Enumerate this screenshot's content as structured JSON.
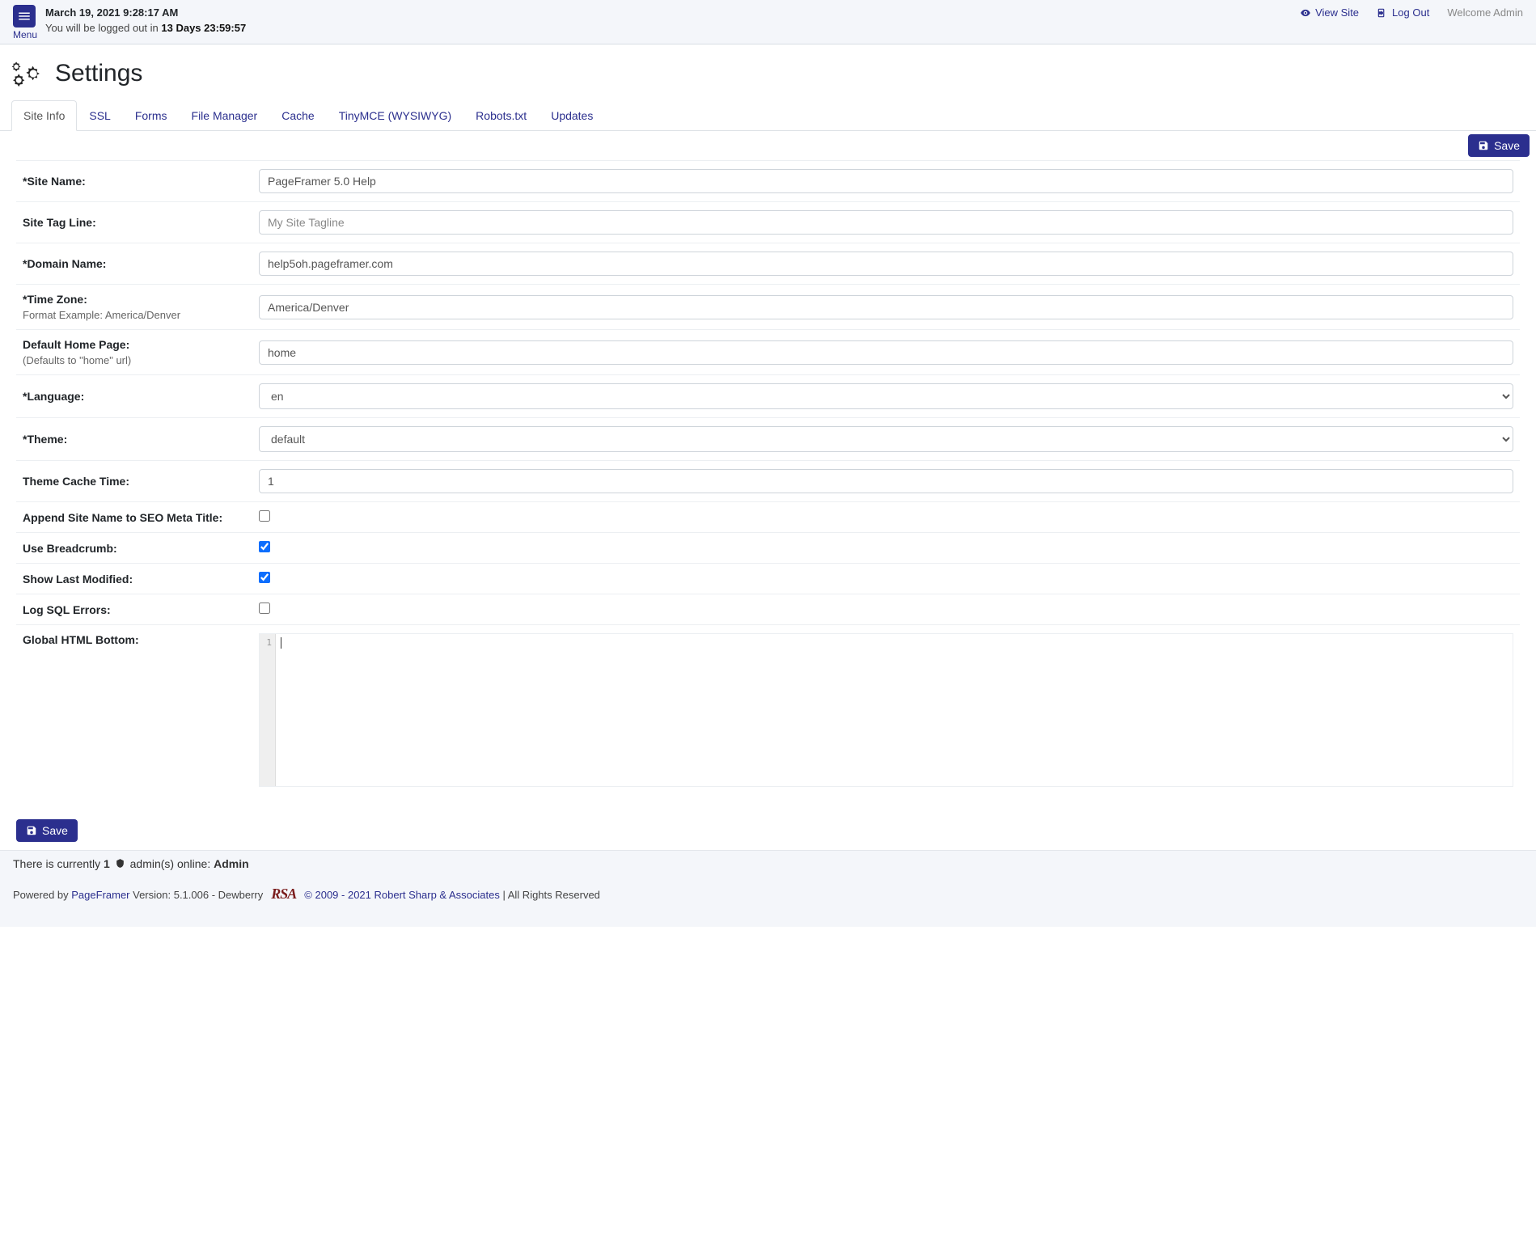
{
  "header": {
    "menu_label": "Menu",
    "datetime": "March 19, 2021 9:28:17 AM",
    "logout_prefix": "You will be logged out in ",
    "logout_time": "13 Days 23:59:57",
    "view_site": "View Site",
    "log_out": "Log Out",
    "welcome": "Welcome Admin"
  },
  "page": {
    "title": "Settings"
  },
  "tabs": [
    {
      "label": "Site Info",
      "active": true
    },
    {
      "label": "SSL"
    },
    {
      "label": "Forms"
    },
    {
      "label": "File Manager"
    },
    {
      "label": "Cache"
    },
    {
      "label": "TinyMCE (WYSIWYG)"
    },
    {
      "label": "Robots.txt"
    },
    {
      "label": "Updates"
    }
  ],
  "buttons": {
    "save": "Save"
  },
  "fields": {
    "site_name": {
      "label": "*Site Name:",
      "value": "PageFramer 5.0 Help"
    },
    "tag_line": {
      "label": "Site Tag Line:",
      "value": "",
      "placeholder": "My Site Tagline"
    },
    "domain": {
      "label": "*Domain Name:",
      "value": "help5oh.pageframer.com"
    },
    "timezone": {
      "label": "*Time Zone:",
      "sub": "Format Example: America/Denver",
      "value": "America/Denver"
    },
    "homepage": {
      "label": "Default Home Page:",
      "sub": "(Defaults to \"home\" url)",
      "value": "home"
    },
    "language": {
      "label": "*Language:",
      "value": "en"
    },
    "theme": {
      "label": "*Theme:",
      "value": "default"
    },
    "cache_time": {
      "label": "Theme Cache Time:",
      "value": "1"
    },
    "seo_title": {
      "label": "Append Site Name to SEO Meta Title:",
      "checked": false
    },
    "breadcrumb": {
      "label": "Use Breadcrumb:",
      "checked": true
    },
    "last_mod": {
      "label": "Show Last Modified:",
      "checked": true
    },
    "log_sql": {
      "label": "Log SQL Errors:",
      "checked": false
    },
    "html_bottom": {
      "label": "Global HTML Bottom:",
      "line_no": "1"
    }
  },
  "status": {
    "prefix": "There is currently ",
    "count": "1",
    "mid": " admin(s) online: ",
    "name": "Admin"
  },
  "footer": {
    "powered_by": "Powered by ",
    "app_link": "PageFramer",
    "version": " Version: 5.1.006 - Dewberry",
    "rsa": "RSA",
    "copyright": "© 2009 - 2021 Robert Sharp & Associates",
    "rights": " | All Rights Reserved"
  }
}
